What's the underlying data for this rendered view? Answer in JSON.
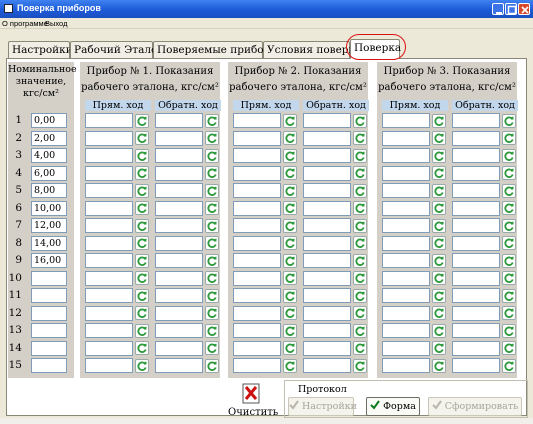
{
  "window": {
    "title": "Поверка приборов"
  },
  "menu": [
    "О программе",
    "Выход"
  ],
  "tabs": [
    {
      "label": "Настройки",
      "active": false
    },
    {
      "label": "Рабочий Эталон",
      "active": false
    },
    {
      "label": "Поверяемые приборы",
      "active": false
    },
    {
      "label": "Условия поверки",
      "active": false
    },
    {
      "label": "Поверка",
      "active": true
    }
  ],
  "nominal": {
    "header": [
      "Номинальное",
      "значение,",
      "кгс/см²"
    ],
    "values": [
      "0,00",
      "2,00",
      "4,00",
      "6,00",
      "8,00",
      "10,00",
      "12,00",
      "14,00",
      "16,00",
      "",
      "",
      "",
      "",
      "",
      ""
    ]
  },
  "row_numbers": [
    "1",
    "2",
    "3",
    "4",
    "5",
    "6",
    "7",
    "8",
    "9",
    "10",
    "11",
    "12",
    "13",
    "14",
    "15"
  ],
  "instruments": [
    {
      "title": "Прибор № 1.  Показания",
      "subtitle": "рабочего эталона, кгс/см²",
      "forward": "Прям. ход",
      "reverse": "Обратн. ход"
    },
    {
      "title": "Прибор № 2.  Показания",
      "subtitle": "рабочего эталона, кгс/см²",
      "forward": "Прям. ход",
      "reverse": "Обратн. ход"
    },
    {
      "title": "Прибор № 3.  Показания",
      "subtitle": "рабочего эталона, кгс/см²",
      "forward": "Прям. ход",
      "reverse": "Обратн. ход"
    }
  ],
  "actions": {
    "clear_label": "Очистить",
    "protocol_label": "Протокол",
    "settings_label": "Настройки",
    "form_label": "Форма",
    "generate_label": "Сформировать"
  },
  "colors": {
    "accent_blue": "#C2D6EC",
    "group_gray": "#D4D0C8",
    "refresh_green": "#2E9A3C",
    "highlight_red": "#DD1111"
  }
}
